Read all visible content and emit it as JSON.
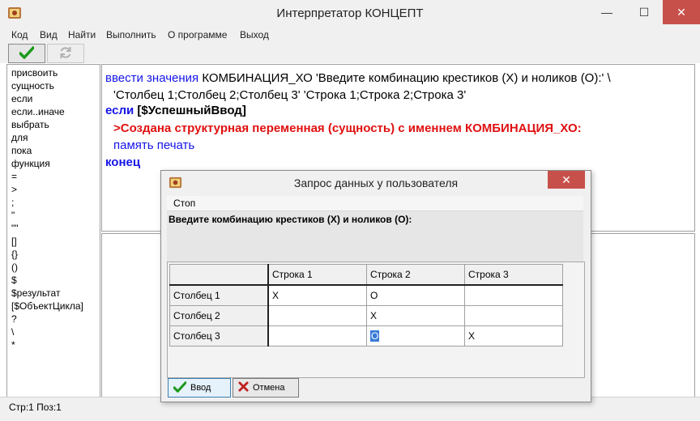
{
  "window": {
    "title": "Интерпретатор КОНЦЕПТ",
    "minimize_glyph": "—",
    "maximize_glyph": "☐",
    "close_glyph": "✕",
    "app_icon": "concept-app-icon"
  },
  "menu": [
    "Код",
    "Вид",
    "Найти",
    "Выполнить",
    "О программе",
    "Выход"
  ],
  "toolbar": {
    "run_icon": "check-icon",
    "refresh_icon": "refresh-icon"
  },
  "keywords": [
    "присвоить",
    "сущность",
    "если",
    "если..иначе",
    "выбрать",
    "для",
    "пока",
    "функция",
    "=",
    ">",
    ";",
    "\"",
    "\"\"",
    "[]",
    "{}",
    "()",
    "$",
    "$результат",
    "[$ОбъектЦикла]",
    "?",
    "\\",
    "*"
  ],
  "editor": {
    "line1_cmd": "ввести значения",
    "line1_rest": " КОМБИНАЦИЯ_ХО 'Введите комбинацию крестиков (X) и ноликов (O):' \\",
    "line2": "'Столбец 1;Столбец 2;Столбец 3' 'Строка 1;Строка 2;Строка 3'",
    "line3_kw": "если",
    "line3_cond": " [$УспешныйВвод]",
    "line4": ">Создана структурная переменная (сущность) с именнем КОМБИНАЦИЯ_ХО:",
    "line5": "память печать",
    "line6": "конец"
  },
  "status": {
    "position": "Стр:1 Поз:1"
  },
  "dialog": {
    "title": "Запрос данных у пользователя",
    "menu_stop": "Стоп",
    "prompt": "Введите комбинацию крестиков (X) и ноликов (O):",
    "columns": [
      "Строка 1",
      "Строка 2",
      "Строка 3"
    ],
    "rows": [
      {
        "label": "Столбец 1",
        "cells": [
          "X",
          "O",
          ""
        ]
      },
      {
        "label": "Столбец 2",
        "cells": [
          "",
          "X",
          ""
        ]
      },
      {
        "label": "Столбец 3",
        "cells": [
          "",
          "O",
          "X"
        ]
      }
    ],
    "ok_label": "Ввод",
    "cancel_label": "Отмена",
    "ok_icon": "check-icon",
    "cancel_icon": "cross-icon"
  },
  "colors": {
    "keyword_blue": "#1515e8",
    "message_red": "#e01010",
    "close_red": "#c7514a",
    "selection_blue": "#3a7bd5",
    "check_green": "#1a9a1a"
  }
}
